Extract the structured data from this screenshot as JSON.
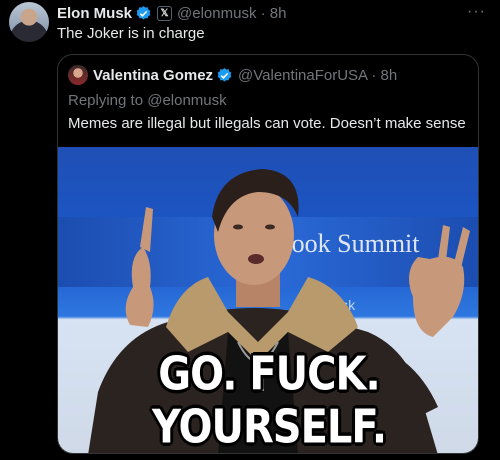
{
  "tweet": {
    "author_name": "Elon Musk",
    "x_badge": "𝕏",
    "handle_time": "@elonmusk · 8h",
    "text": "The Joker is in charge"
  },
  "quote": {
    "author_name": "Valentina Gomez",
    "handle_time": "@ValentinaForUSA · 8h",
    "replying_to": "Replying to @elonmusk",
    "text": "Memes are illegal but illegals can vote. Doesn’t make sense",
    "image": {
      "banner_text": "ealBook Summit",
      "banner_sub": "n Musk",
      "caption": "GO. FUCK. YOURSELF."
    }
  },
  "icons": {
    "verified": "verified-badge-icon",
    "more": "more-icon"
  },
  "colors": {
    "background": "#000000",
    "text": "#e7e9ea",
    "muted": "#71767b",
    "border": "#2f3336",
    "verified": "#1d9bf0"
  }
}
